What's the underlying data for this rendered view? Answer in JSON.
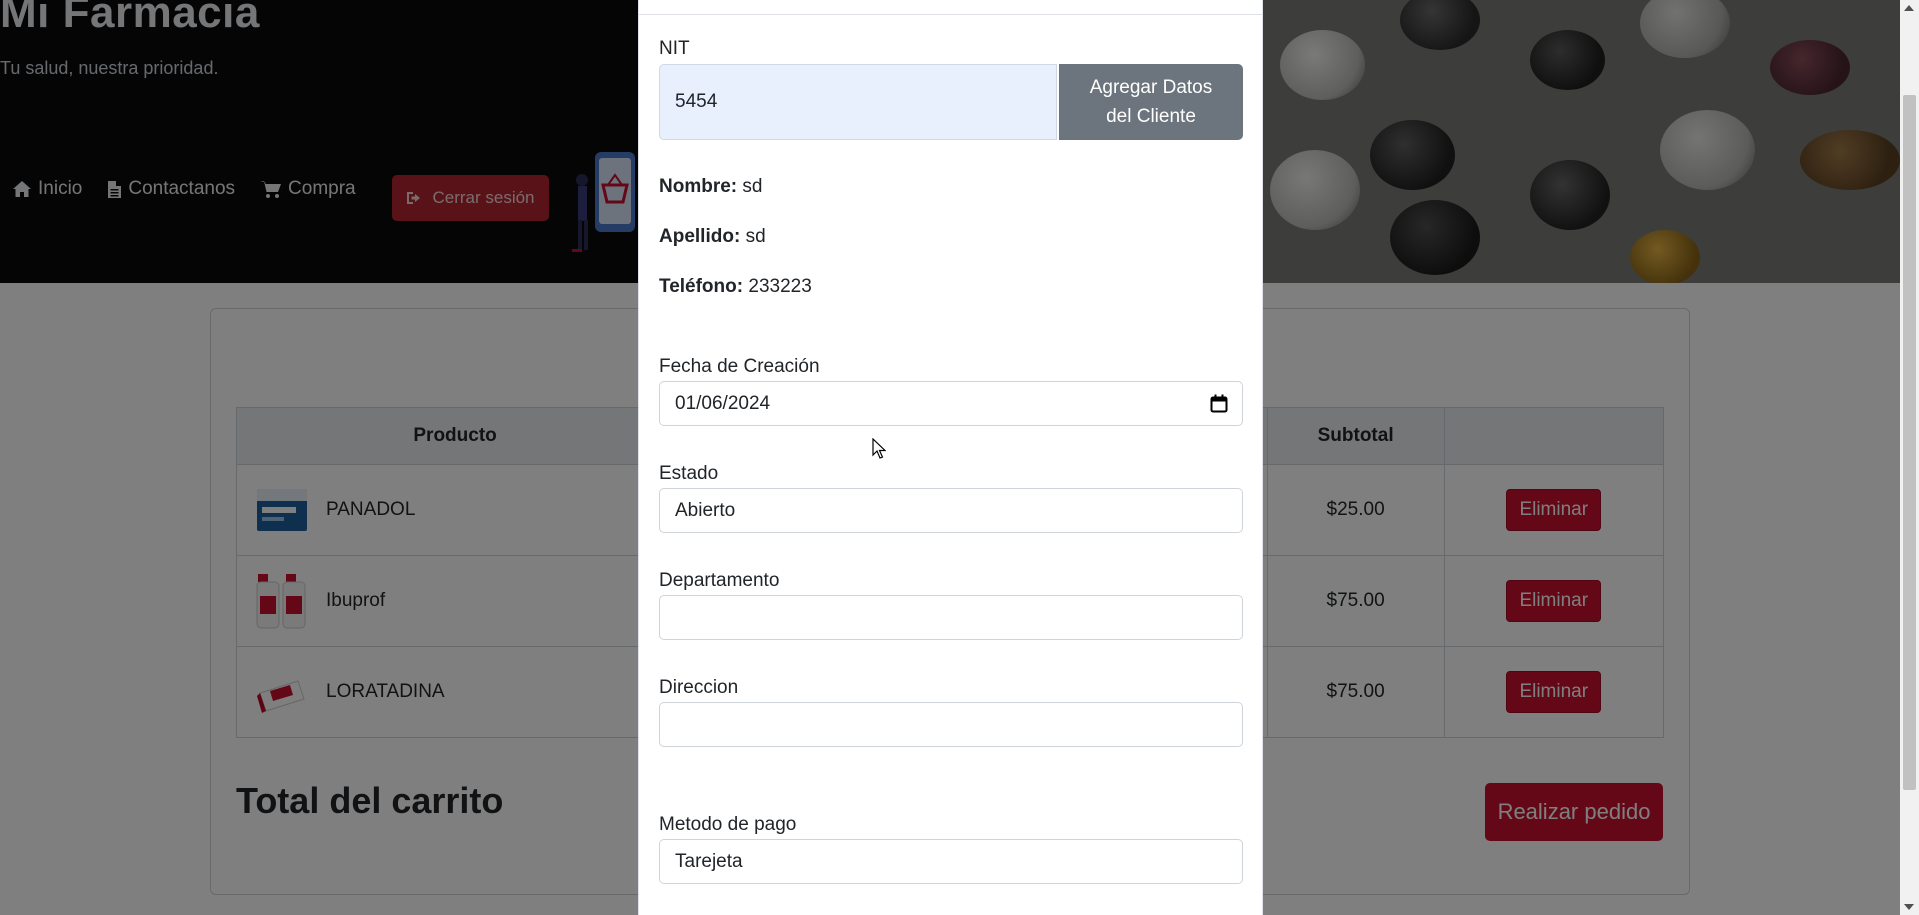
{
  "header": {
    "title": "Mi Farmacia",
    "tagline": "Tu salud, nuestra prioridad.",
    "nav": [
      {
        "label": "Inicio",
        "icon": "home-icon"
      },
      {
        "label": "Contactanos",
        "icon": "file-icon"
      },
      {
        "label": "Compra",
        "icon": "cart-icon"
      }
    ],
    "logout_label": "Cerrar sesión"
  },
  "cart": {
    "columns": {
      "product": "Producto",
      "subtotal": "Subtotal"
    },
    "rows": [
      {
        "name": "PANADOL",
        "subtotal": "$25.00",
        "action": "Eliminar"
      },
      {
        "name": "Ibuprof",
        "subtotal": "$75.00",
        "action": "Eliminar"
      },
      {
        "name": "LORATADINA",
        "subtotal": "$75.00",
        "action": "Eliminar"
      }
    ],
    "total_title": "Total del carrito",
    "order_button": "Realizar pedido"
  },
  "modal": {
    "nit_label": "NIT",
    "nit_value": "5454",
    "add_client_button": "Agregar Datos del Cliente",
    "nombre_label": "Nombre:",
    "nombre_value": "sd",
    "apellido_label": "Apellido:",
    "apellido_value": "sd",
    "telefono_label": "Teléfono:",
    "telefono_value": "233223",
    "fecha_label": "Fecha de Creación",
    "fecha_value": "01/06/2024",
    "estado_label": "Estado",
    "estado_value": "Abierto",
    "departamento_label": "Departamento",
    "departamento_value": "",
    "direccion_label": "Direccion",
    "direccion_value": "",
    "pago_label": "Metodo de pago",
    "pago_value": "Tarejeta"
  },
  "colors": {
    "danger": "#c8102e",
    "secondary": "#6c757d",
    "autofill": "#e8f0fe"
  }
}
